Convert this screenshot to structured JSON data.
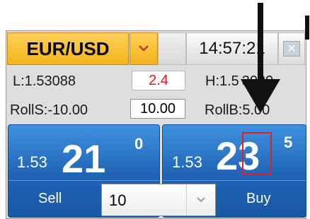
{
  "header": {
    "pair": "EUR/USD",
    "time": "14:57:21"
  },
  "stats": {
    "low": "L:1.53088",
    "spread": "2.4",
    "high": "H:1.5 3039",
    "roll_sell": "RollS:-10.00",
    "roll_input": "10.00",
    "roll_buy": "RollB:5.00"
  },
  "sell": {
    "prefix": "1.53",
    "big": "21",
    "pip": "0",
    "label": "Sell"
  },
  "buy": {
    "prefix": "1.53",
    "big": "23",
    "pip": "5",
    "label": "Buy"
  },
  "quantity": {
    "value": "10"
  },
  "icons": {
    "dropdown": "chevron-down-icon",
    "close": "close-icon",
    "annotation": "arrow-pointer-icon"
  },
  "colors": {
    "pair_bg": "#f4b21c",
    "tile_bg": "#1f63b4",
    "spread_text": "#e0161b",
    "highlight": "#e02020"
  }
}
